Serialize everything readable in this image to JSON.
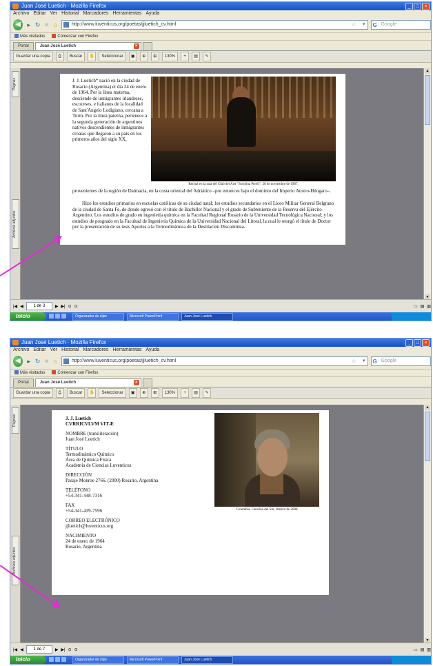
{
  "screen1": {
    "window_title": "Juan José Luetich · Mozilla Firefox",
    "menu": [
      "Archivo",
      "Editar",
      "Ver",
      "Historial",
      "Marcadores",
      "Herramientas",
      "Ayuda"
    ],
    "url": "http://www.luventicus.org/poetas/jjluetich_cv.html",
    "search_placeholder": "Google",
    "bookmarks": [
      "Más visitados",
      "Comenzar con Firefox"
    ],
    "tabs": [
      "Portal",
      "Juan José Luetich"
    ],
    "pdf_toolbar": [
      "Guardar una copia",
      "Buscar",
      "Seleccionar",
      "130%"
    ],
    "side_tab_pages": "Páginas",
    "side_tab_attach": "Archivos adjuntos",
    "page_number": "1 de 3",
    "status": "Done",
    "taskbar": [
      "Inicio",
      "Organizador de clips",
      "Microsoft PowerPoint",
      "Juan José Luetich"
    ],
    "tray": "",
    "bio_col": "J. J. Luetich* nació en la ciudad de Rosario (Argentina) el día 24 de enero de 1964. Por la línea materna, desciende de inmigrantes irlandeses, escoceses, e italianos de la localidad de Sant'Angelo Lodigiano, cercana a Turín. Por la línea paterna, pertenece a la segunda generación de argentinos nativos descendientes de inmigrantes croatas que llegaron a su país en los primeros años del siglo XX,",
    "bio_full": "provenientes de la región de Dalmacia, en la costa oriental del Adriático –por entonces bajo el dominio del Imperio Austro-Húngaro–.",
    "bio_full2": "Hizo los estudios primarios en escuelas católicas de su ciudad natal; los estudios secundarios en el Liceo Militar General Belgrano de la ciudad de Santa Fe, de donde egresó con el título de Bachiller Nacional y el grado de Subteniente de la Reserva del Ejército Argentino. Los estudios de grado en ingeniería química en la Facultad Regional Rosario de la Universidad Tecnológica Nacional; y los estudios de posgrado en la Facultad de Ingeniería Química de la Universidad Nacional del Litoral, la cual le otorgó el título de Doctor por la presentación de su tesis Aportes a la Termodinámica de la Destilación Discontinua.",
    "photo_caption": "Recital en la sala del Club del Arte \"Sorolina Pereli\", 28 de noviembre de 1987."
  },
  "screen2": {
    "window_title": "Juan José Luetich · Mozilla Firefox",
    "menu": [
      "Archivo",
      "Editar",
      "Ver",
      "Historial",
      "Marcadores",
      "Herramientas",
      "Ayuda"
    ],
    "url": "http://www.luventicus.org/poetas/jjluetich_cv.html",
    "search_placeholder": "Google",
    "bookmarks": [
      "Más visitados",
      "Comenzar con Firefox"
    ],
    "tabs": [
      "Portal",
      "Juan José Luetich"
    ],
    "pdf_toolbar": [
      "Guardar una copia",
      "Buscar",
      "Seleccionar",
      "130%"
    ],
    "side_tab_pages": "Páginas",
    "side_tab_attach": "Archivos adjuntos",
    "page_number": "1 de 7",
    "status": "Terminado",
    "taskbar": [
      "Inicio",
      "Organizador de clips",
      "Microsoft PowerPoint",
      "Juan José Luetich"
    ],
    "cv_title1": "J. J. Luetich",
    "cv_title2": "CVRRICVLVM VITÆ",
    "cv": [
      {
        "label": "NOMBRE (transliteración)",
        "value": "Juan José Luetich"
      },
      {
        "label": "TÍTULO",
        "value": "Termodinámico Químico\nÁrea de Química Física\nAcademia de Ciencias Luventicus"
      },
      {
        "label": "DIRECCIÓN",
        "value": "Pasaje Monroe 2766, (2000) Rosario, Argentina"
      },
      {
        "label": "TELÉFONO",
        "value": "+54-341-448-7316"
      },
      {
        "label": "FAX",
        "value": "+54-341-439-7596"
      },
      {
        "label": "CORREO ELECTRÓNICO",
        "value": "jjluetich@luventicus.org"
      },
      {
        "label": "NACIMIENTO",
        "value": "24 de enero de 1964\nRosario, Argentina"
      }
    ],
    "photo_caption": "Colombia, Carolina del Sur, febrero de 2008"
  },
  "colors": {
    "arrow": "#e62ad6",
    "xp_blue": "#2456c8",
    "viewer_bg": "#7a7a80"
  }
}
